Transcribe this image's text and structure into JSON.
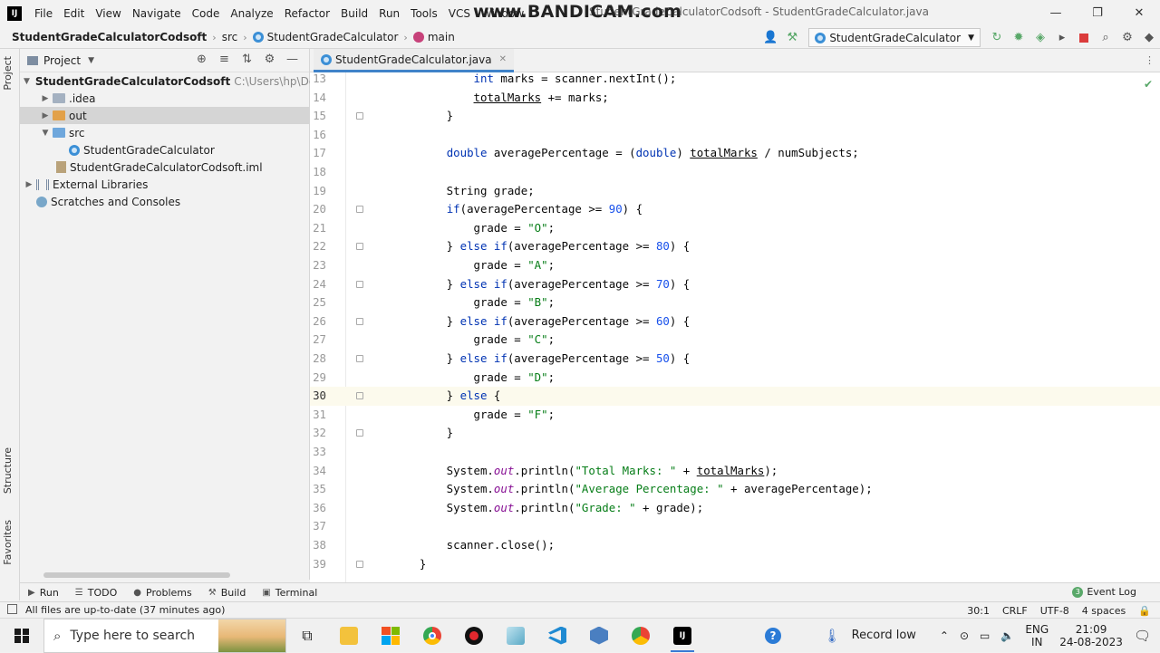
{
  "menubar": {
    "items": [
      "File",
      "Edit",
      "View",
      "Navigate",
      "Code",
      "Analyze",
      "Refactor",
      "Build",
      "Run",
      "Tools",
      "VCS",
      "Window",
      "Help"
    ],
    "window_title": "StudentGradeCalculatorCodsoft - StudentGradeCalculator.java",
    "watermark": "www.BANDICAM.com"
  },
  "navbar": {
    "project": "StudentGradeCalculatorCodsoft",
    "src": "src",
    "class": "StudentGradeCalculator",
    "method": "main",
    "run_config": "StudentGradeCalculator"
  },
  "sidebar_tabs": {
    "project": "Project",
    "structure": "Structure",
    "favorites": "Favorites"
  },
  "project_panel": {
    "title": "Project",
    "tree": [
      {
        "label": "StudentGradeCalculatorCodsoft",
        "hint": "C:\\Users\\hp\\Desktop\\",
        "arrow": "▼",
        "icon": "folder"
      },
      {
        "label": ".idea",
        "arrow": "▶",
        "icon": "folder"
      },
      {
        "label": "out",
        "arrow": "▶",
        "icon": "folder-orange"
      },
      {
        "label": "src",
        "arrow": "▼",
        "icon": "folder-blue"
      },
      {
        "label": "StudentGradeCalculator",
        "arrow": "",
        "icon": "class"
      },
      {
        "label": "StudentGradeCalculatorCodsoft.iml",
        "arrow": "",
        "icon": "iml-file"
      },
      {
        "label": "External Libraries",
        "arrow": "▶",
        "icon": "library"
      },
      {
        "label": "Scratches and Consoles",
        "arrow": "",
        "icon": "scratch"
      }
    ]
  },
  "editor": {
    "tab": "StudentGradeCalculator.java",
    "current_line": 30,
    "lines": [
      {
        "n": "13",
        "tokens": [
          [
            "            ",
            ""
          ],
          [
            "int",
            "kw"
          ],
          [
            " marks = scanner.nextInt();",
            ""
          ]
        ]
      },
      {
        "n": "14",
        "tokens": [
          [
            "            ",
            ""
          ],
          [
            "totalMarks",
            "ul"
          ],
          [
            " += marks;",
            ""
          ]
        ]
      },
      {
        "n": "15",
        "tokens": [
          [
            "        }",
            ""
          ]
        ]
      },
      {
        "n": "16",
        "tokens": []
      },
      {
        "n": "17",
        "tokens": [
          [
            "        ",
            ""
          ],
          [
            "double",
            "kw"
          ],
          [
            " averagePercentage = (",
            ""
          ],
          [
            "double",
            "kw"
          ],
          [
            ") ",
            ""
          ],
          [
            "totalMarks",
            "ul"
          ],
          [
            " / numSubjects;",
            ""
          ]
        ]
      },
      {
        "n": "18",
        "tokens": []
      },
      {
        "n": "19",
        "tokens": [
          [
            "        String grade;",
            ""
          ]
        ]
      },
      {
        "n": "20",
        "tokens": [
          [
            "        ",
            ""
          ],
          [
            "if",
            "kw"
          ],
          [
            "(averagePercentage >= ",
            ""
          ],
          [
            "90",
            "num"
          ],
          [
            ") {",
            ""
          ]
        ]
      },
      {
        "n": "21",
        "tokens": [
          [
            "            grade = ",
            ""
          ],
          [
            "\"O\"",
            "str"
          ],
          [
            ";",
            ""
          ]
        ]
      },
      {
        "n": "22",
        "tokens": [
          [
            "        } ",
            ""
          ],
          [
            "else if",
            "kw"
          ],
          [
            "(averagePercentage >= ",
            ""
          ],
          [
            "80",
            "num"
          ],
          [
            ") {",
            ""
          ]
        ]
      },
      {
        "n": "23",
        "tokens": [
          [
            "            grade = ",
            ""
          ],
          [
            "\"A\"",
            "str"
          ],
          [
            ";",
            ""
          ]
        ]
      },
      {
        "n": "24",
        "tokens": [
          [
            "        } ",
            ""
          ],
          [
            "else if",
            "kw"
          ],
          [
            "(averagePercentage >= ",
            ""
          ],
          [
            "70",
            "num"
          ],
          [
            ") {",
            ""
          ]
        ]
      },
      {
        "n": "25",
        "tokens": [
          [
            "            grade = ",
            ""
          ],
          [
            "\"B\"",
            "str"
          ],
          [
            ";",
            ""
          ]
        ]
      },
      {
        "n": "26",
        "tokens": [
          [
            "        } ",
            ""
          ],
          [
            "else if",
            "kw"
          ],
          [
            "(averagePercentage >= ",
            ""
          ],
          [
            "60",
            "num"
          ],
          [
            ") {",
            ""
          ]
        ]
      },
      {
        "n": "27",
        "tokens": [
          [
            "            grade = ",
            ""
          ],
          [
            "\"C\"",
            "str"
          ],
          [
            ";",
            ""
          ]
        ]
      },
      {
        "n": "28",
        "tokens": [
          [
            "        } ",
            ""
          ],
          [
            "else if",
            "kw"
          ],
          [
            "(averagePercentage >= ",
            ""
          ],
          [
            "50",
            "num"
          ],
          [
            ") {",
            ""
          ]
        ]
      },
      {
        "n": "29",
        "tokens": [
          [
            "            grade = ",
            ""
          ],
          [
            "\"D\"",
            "str"
          ],
          [
            ";",
            ""
          ]
        ]
      },
      {
        "n": "30",
        "tokens": [
          [
            "        } ",
            ""
          ],
          [
            "else",
            "kw"
          ],
          [
            " {",
            ""
          ]
        ]
      },
      {
        "n": "31",
        "tokens": [
          [
            "            grade = ",
            ""
          ],
          [
            "\"F\"",
            "str"
          ],
          [
            ";",
            ""
          ]
        ]
      },
      {
        "n": "32",
        "tokens": [
          [
            "        }",
            ""
          ]
        ]
      },
      {
        "n": "33",
        "tokens": []
      },
      {
        "n": "34",
        "tokens": [
          [
            "        System.",
            ""
          ],
          [
            "out",
            "fld"
          ],
          [
            ".println(",
            ""
          ],
          [
            "\"Total Marks: \"",
            "str"
          ],
          [
            " + ",
            ""
          ],
          [
            "totalMarks",
            "ul"
          ],
          [
            ");",
            ""
          ]
        ]
      },
      {
        "n": "35",
        "tokens": [
          [
            "        System.",
            ""
          ],
          [
            "out",
            "fld"
          ],
          [
            ".println(",
            ""
          ],
          [
            "\"Average Percentage: \"",
            "str"
          ],
          [
            " + averagePercentage);",
            ""
          ]
        ]
      },
      {
        "n": "36",
        "tokens": [
          [
            "        System.",
            ""
          ],
          [
            "out",
            "fld"
          ],
          [
            ".println(",
            ""
          ],
          [
            "\"Grade: \"",
            "str"
          ],
          [
            " + grade);",
            ""
          ]
        ]
      },
      {
        "n": "37",
        "tokens": []
      },
      {
        "n": "38",
        "tokens": [
          [
            "        scanner.close();",
            ""
          ]
        ]
      },
      {
        "n": "39",
        "tokens": [
          [
            "    }",
            ""
          ]
        ]
      }
    ]
  },
  "bottom_tabs": [
    "Run",
    "TODO",
    "Problems",
    "Build",
    "Terminal"
  ],
  "event_log": {
    "count": "3",
    "label": "Event Log"
  },
  "status": {
    "message": "All files are up-to-date (37 minutes ago)",
    "position": "30:1",
    "line_sep": "CRLF",
    "encoding": "UTF-8",
    "indent": "4 spaces"
  },
  "taskbar": {
    "search_placeholder": "Type here to search",
    "record": "Record low",
    "lang": "ENG",
    "region": "IN",
    "time": "21:09",
    "date": "24-08-2023"
  }
}
